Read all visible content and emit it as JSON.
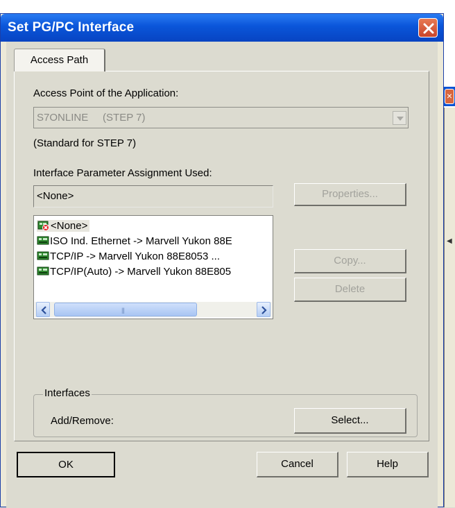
{
  "dialog": {
    "title": "Set PG/PC Interface",
    "tab_label": "Access Path",
    "access_point_label": "Access Point of the Application:",
    "access_point_value": "S7ONLINE     (STEP 7)",
    "access_point_note": "(Standard for STEP 7)",
    "interface_param_label": "Interface Parameter Assignment Used:",
    "interface_param_value": "<None>",
    "properties_button": "Properties...",
    "copy_button": "Copy...",
    "delete_button": "Delete",
    "interface_list": [
      {
        "label": "<None>",
        "icon": "network-card-disabled-icon",
        "selected": true
      },
      {
        "label": "ISO Ind. Ethernet -> Marvell Yukon 88E",
        "icon": "network-card-icon",
        "selected": false
      },
      {
        "label": "TCP/IP -> Marvell Yukon 88E8053 ...",
        "icon": "network-card-icon",
        "selected": false
      },
      {
        "label": "TCP/IP(Auto) -> Marvell Yukon 88E805",
        "icon": "network-card-icon",
        "selected": false
      }
    ],
    "interfaces_group_title": "Interfaces",
    "add_remove_label": "Add/Remove:",
    "select_button": "Select...",
    "ok_button": "OK",
    "cancel_button": "Cancel",
    "help_button": "Help"
  },
  "colors": {
    "title_bar": "#0a55d9",
    "close_button": "#d8553a",
    "face": "#dcdbd0",
    "disabled_text": "#a2a29c"
  }
}
